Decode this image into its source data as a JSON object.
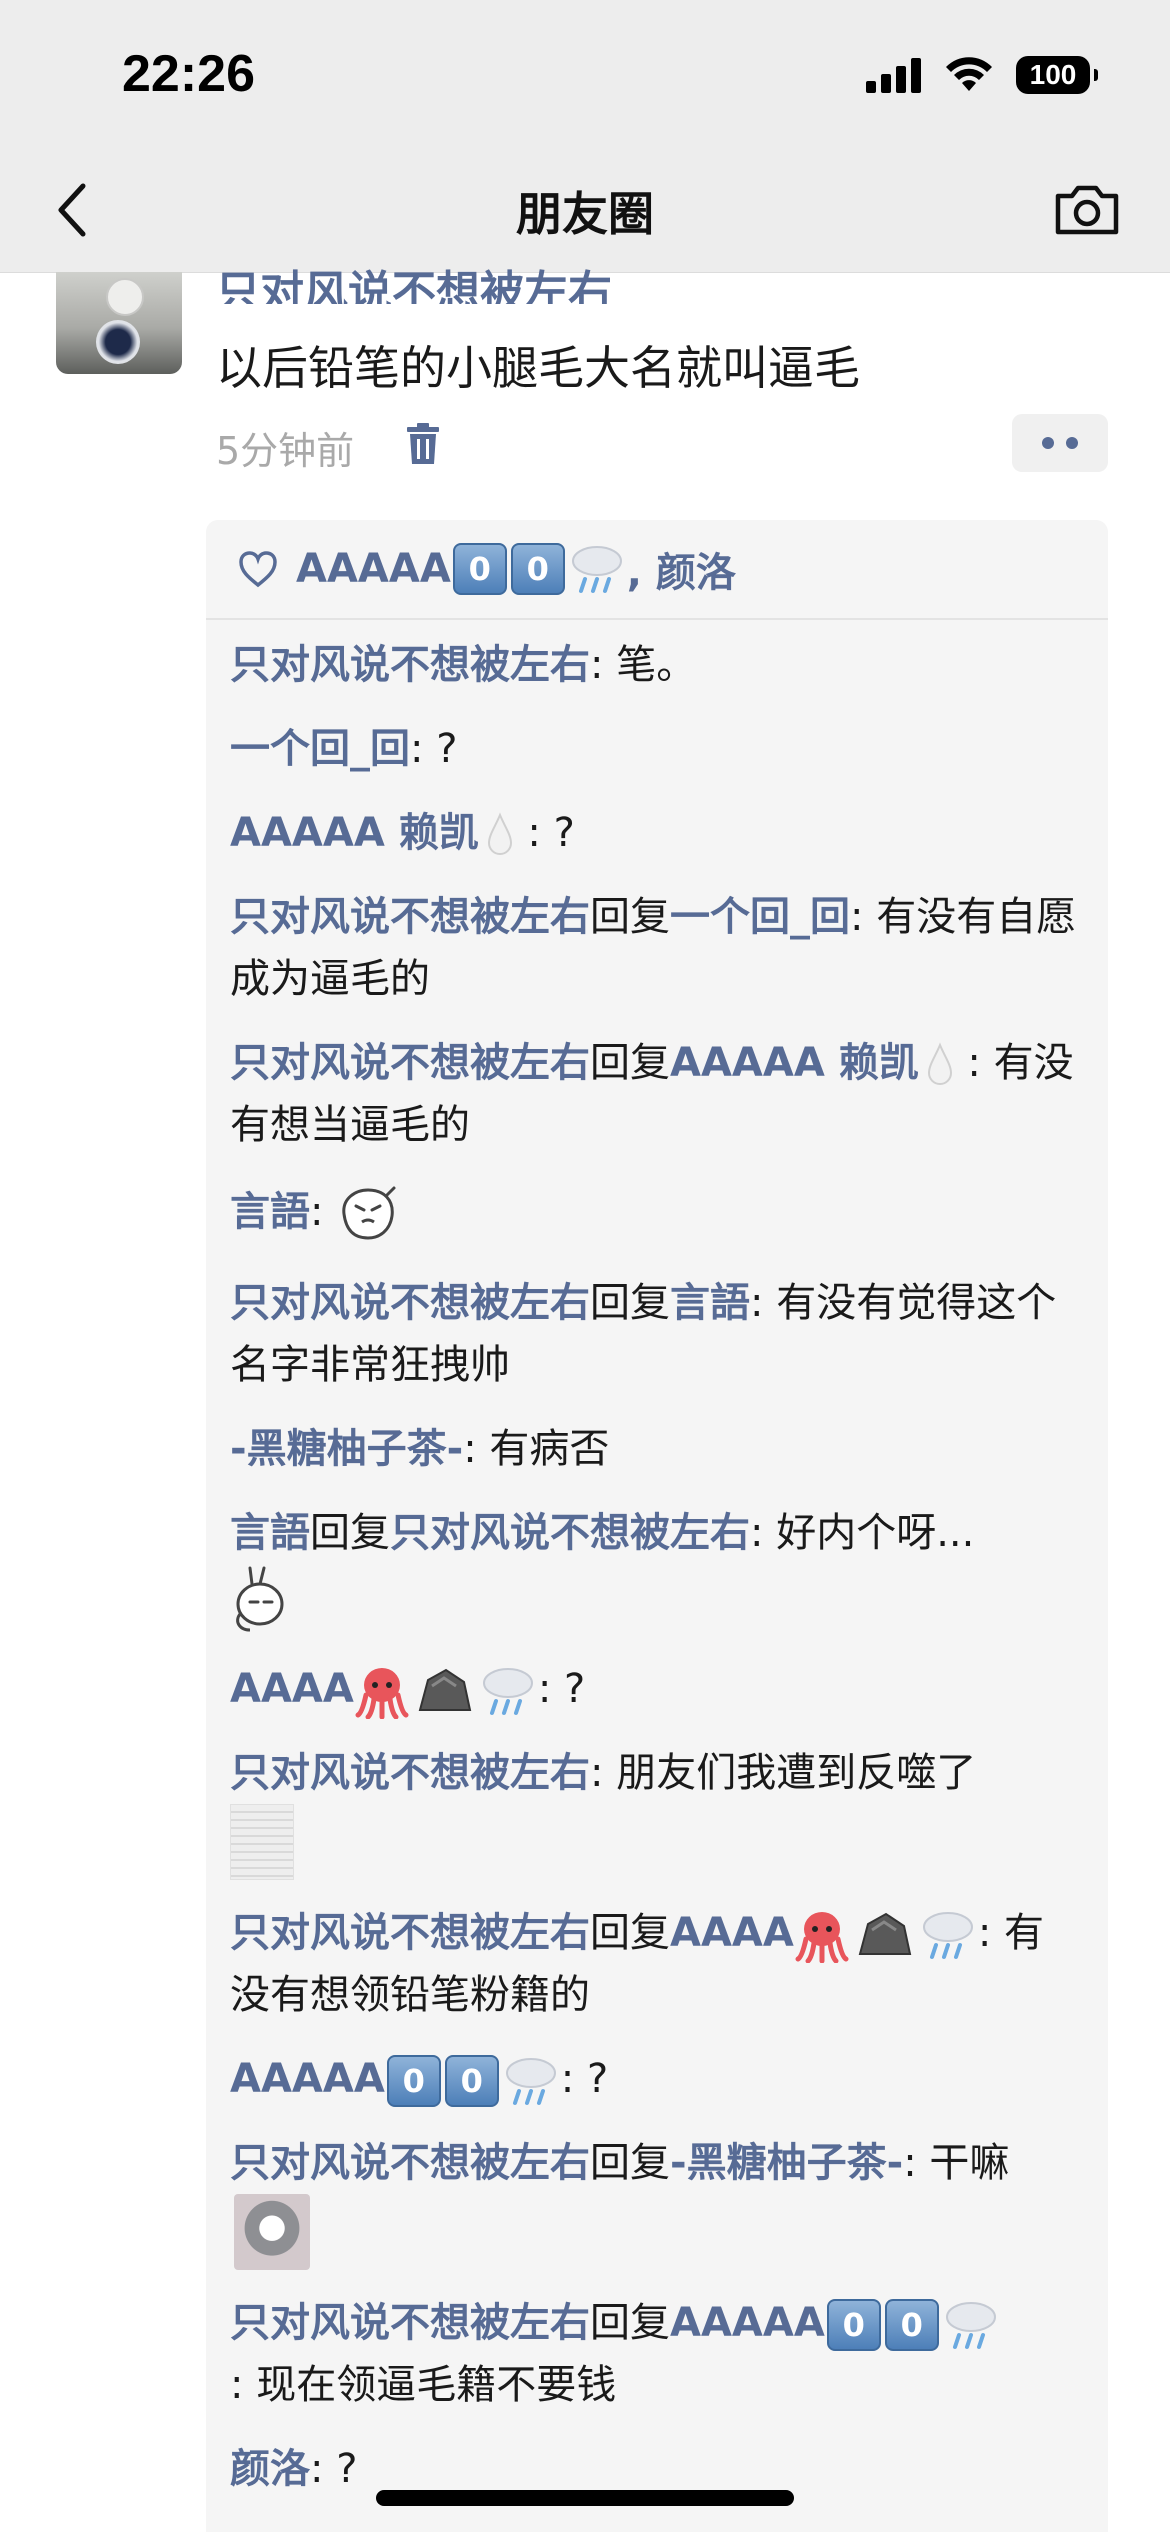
{
  "status_bar": {
    "time": "22:26",
    "battery": "100"
  },
  "nav": {
    "title": "朋友圈"
  },
  "post": {
    "author": "只对风说不想被左右",
    "text": "以后铅笔的小腿毛大名就叫逼毛",
    "time": "5分钟前"
  },
  "likes": {
    "names_a": "AAAAA",
    "names_b": ", 颜洛"
  },
  "comments": [
    {
      "user": "只对风说不想被左右",
      "sep": ": ",
      "text": "笔。"
    },
    {
      "user": "一个回_回",
      "sep": ": ",
      "text": "?"
    },
    {
      "user": "AAAAA 赖凯",
      "sep": " : ",
      "text": "?"
    },
    {
      "user": "只对风说不想被左右",
      "reply_word": "回复",
      "target": "一个回_回",
      "sep": ": ",
      "text": "有没有自愿成为逼毛的"
    },
    {
      "user": "只对风说不想被左右",
      "reply_word": "回复",
      "target": "AAAAA 赖凯",
      "sep": " : ",
      "text": "有没有想当逼毛的"
    },
    {
      "user": "言語",
      "sep": ": "
    },
    {
      "user": "只对风说不想被左右",
      "reply_word": "回复",
      "target": "言語",
      "sep": ": ",
      "text": "有没有觉得这个名字非常狂拽帅"
    },
    {
      "user": "-黑糖柚子茶-",
      "sep": ": ",
      "text": "有病否"
    },
    {
      "user": "言語",
      "reply_word": "回复",
      "target": "只对风说不想被左右",
      "sep": ": ",
      "text": "好内个呀..."
    },
    {
      "user": "AAAA",
      "sep": ": ",
      "text": "?"
    },
    {
      "user": "只对风说不想被左右",
      "sep": ": ",
      "text": "朋友们我遭到反噬了"
    },
    {
      "user": "只对风说不想被左右",
      "reply_word": "回复",
      "target": "AAAA",
      "sep": ": ",
      "text": "有没有想领铅笔粉籍的"
    },
    {
      "user": "AAAAA",
      "sep": ": ",
      "text": "?"
    },
    {
      "user": "只对风说不想被左右",
      "reply_word": "回复",
      "target": "-黑糖柚子茶-",
      "sep": ": ",
      "text": "干嘛"
    },
    {
      "user": "只对风说不想被左右",
      "reply_word": "回复",
      "target": "AAAAA",
      "sep": ": ",
      "text": "现在领逼毛籍不要钱"
    },
    {
      "user": "颜洛",
      "sep": ": ",
      "text": "?"
    }
  ],
  "emoji": {
    "zero": "0"
  },
  "colors": {
    "link": "#576b95",
    "nav_bg": "#ededed",
    "comment_bg": "#f5f5f5"
  }
}
